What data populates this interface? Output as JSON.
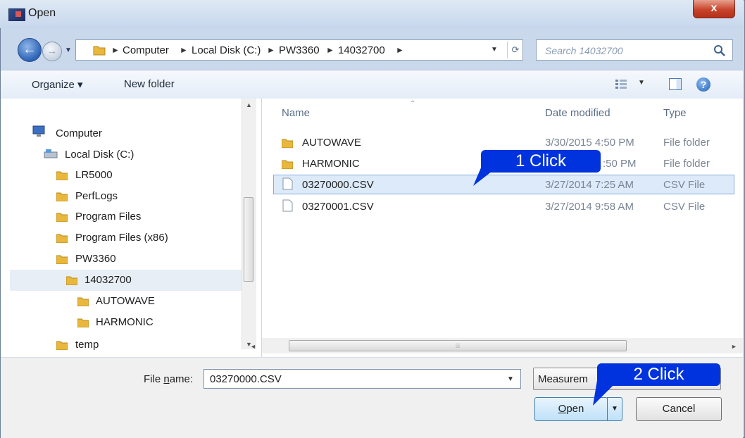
{
  "window": {
    "title": "Open",
    "close_glyph": "x"
  },
  "nav": {
    "back_glyph": "←",
    "forward_glyph": "→",
    "breadcrumbs": [
      "Computer",
      "Local Disk (C:)",
      "PW3360",
      "14032700"
    ],
    "search_placeholder": "Search 14032700"
  },
  "toolbar": {
    "organize_label": "Organize ▾",
    "new_folder_label": "New folder",
    "help_glyph": "?"
  },
  "sidebar": {
    "items": [
      {
        "label": "Computer",
        "icon": "computer-icon"
      },
      {
        "label": "Local Disk (C:)",
        "icon": "drive-icon"
      },
      {
        "label": "LR5000",
        "icon": "folder-icon"
      },
      {
        "label": "PerfLogs",
        "icon": "folder-icon"
      },
      {
        "label": "Program Files",
        "icon": "folder-icon"
      },
      {
        "label": "Program Files (x86)",
        "icon": "folder-icon"
      },
      {
        "label": "PW3360",
        "icon": "folder-icon"
      },
      {
        "label": "14032700",
        "icon": "folder-icon",
        "selected": true
      },
      {
        "label": "AUTOWAVE",
        "icon": "folder-icon"
      },
      {
        "label": "HARMONIC",
        "icon": "folder-icon"
      },
      {
        "label": "temp",
        "icon": "folder-icon"
      }
    ]
  },
  "filelist": {
    "columns": [
      "Name",
      "Date modified",
      "Type"
    ],
    "rows": [
      {
        "name": "AUTOWAVE",
        "date": "3/30/2015 4:50 PM",
        "type": "File folder",
        "icon": "folder-icon"
      },
      {
        "name": "HARMONIC",
        "date": ":50 PM",
        "type": "File folder",
        "icon": "folder-icon"
      },
      {
        "name": "03270000.CSV",
        "date": "3/27/2014 7:25 AM",
        "type": "CSV File",
        "icon": "file-icon",
        "selected": true
      },
      {
        "name": "03270001.CSV",
        "date": "3/27/2014 9:58 AM",
        "type": "CSV File",
        "icon": "file-icon"
      }
    ]
  },
  "bottom": {
    "file_name_label_pre": "File ",
    "file_name_label_u": "n",
    "file_name_label_post": "ame:",
    "file_name_value": "03270000.CSV",
    "filter_value": "Measurem",
    "open_label_u": "O",
    "open_label_rest": "pen",
    "cancel_label": "Cancel"
  },
  "callouts": {
    "first": "1  Click",
    "second": "2  Click"
  },
  "colors": {
    "callout": "#0033dd",
    "selection": "#dceaf9",
    "titlebar": "#c7d7ec"
  }
}
